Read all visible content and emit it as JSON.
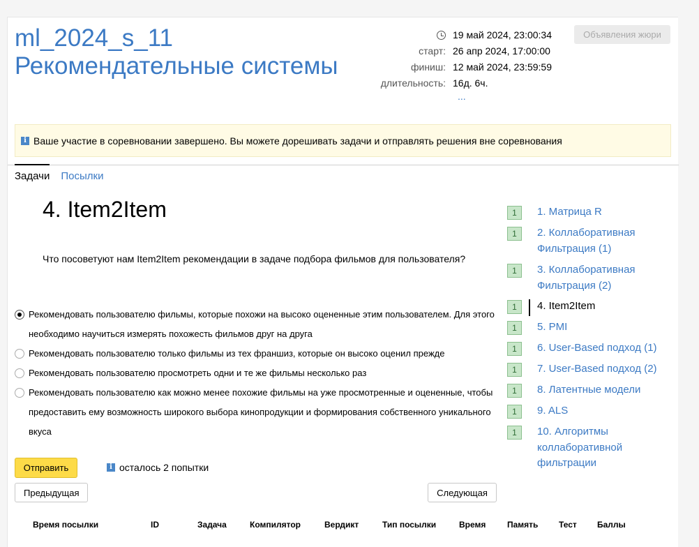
{
  "contest": {
    "code": "ml_2024_s_11",
    "name": "Рекомендательные системы",
    "current_time": "19 май 2024, 23:00:34",
    "start_label": "старт:",
    "start": "26 апр 2024, 17:00:00",
    "finish_label": "финиш:",
    "finish": "12 май 2024, 23:59:59",
    "duration_label": "длительность:",
    "duration": "16д. 6ч.",
    "more": "...",
    "jury_button": "Объявления жюри"
  },
  "notice": {
    "icon": "info-icon",
    "text": "Ваше участие в соревновании завершено. Вы можете дорешивать задачи и отправлять решения вне соревнования"
  },
  "tabs": [
    {
      "label": "Задачи",
      "active": true
    },
    {
      "label": "Посылки",
      "active": false
    }
  ],
  "problem": {
    "title": "4. Item2Item",
    "question": "Что посоветуют нам Item2Item рекомендации в задаче подбора фильмов для пользователя?",
    "options": [
      {
        "text": "Рекомендовать пользователю фильмы, которые похожи на высоко оцененные этим пользователем. Для этого необходимо научиться измерять похожесть фильмов друг на друга",
        "checked": true
      },
      {
        "text": "Рекомендовать пользователю только фильмы из тех франшиз, которые он высоко оценил прежде",
        "checked": false
      },
      {
        "text": "Рекомендовать пользователю просмотреть одни и те же фильмы несколько раз",
        "checked": false
      },
      {
        "text": "Рекомендовать пользователю как можно менее похожие фильмы на уже просмотренные и оцененные, чтобы предоставить ему возможность широкого выбора кинопродукции и формирования собственного уникального вкуса",
        "checked": false
      }
    ],
    "submit_label": "Отправить",
    "attempts_text": "осталось 2 попытки",
    "prev_label": "Предыдущая",
    "next_label": "Следующая"
  },
  "submissions_table": {
    "columns": [
      "Время посылки",
      "ID",
      "Задача",
      "Компилятор",
      "Вердикт",
      "Тип посылки",
      "Время",
      "Память",
      "Тест",
      "Баллы"
    ]
  },
  "sidebar": {
    "items": [
      {
        "badge": "1",
        "label": "1. Матрица R",
        "active": false
      },
      {
        "badge": "1",
        "label": "2. Коллаборативная Фильтрация (1)",
        "active": false
      },
      {
        "badge": "1",
        "label": "3. Коллаборативная Фильтрация (2)",
        "active": false
      },
      {
        "badge": "1",
        "label": "4. Item2Item",
        "active": true
      },
      {
        "badge": "1",
        "label": "5. PMI",
        "active": false
      },
      {
        "badge": "1",
        "label": "6. User-Based подход (1)",
        "active": false
      },
      {
        "badge": "1",
        "label": "7. User-Based подход (2)",
        "active": false
      },
      {
        "badge": "1",
        "label": "8. Латентные модели",
        "active": false
      },
      {
        "badge": "1",
        "label": "9. ALS",
        "active": false
      },
      {
        "badge": "1",
        "label": "10. Алгоритмы коллаборативной фильтрации",
        "active": false
      }
    ]
  },
  "colors": {
    "link": "#3c7ac4",
    "submit": "#fddb48",
    "badge_bg": "#c8e6c9",
    "notice_bg": "#fffbe5"
  }
}
